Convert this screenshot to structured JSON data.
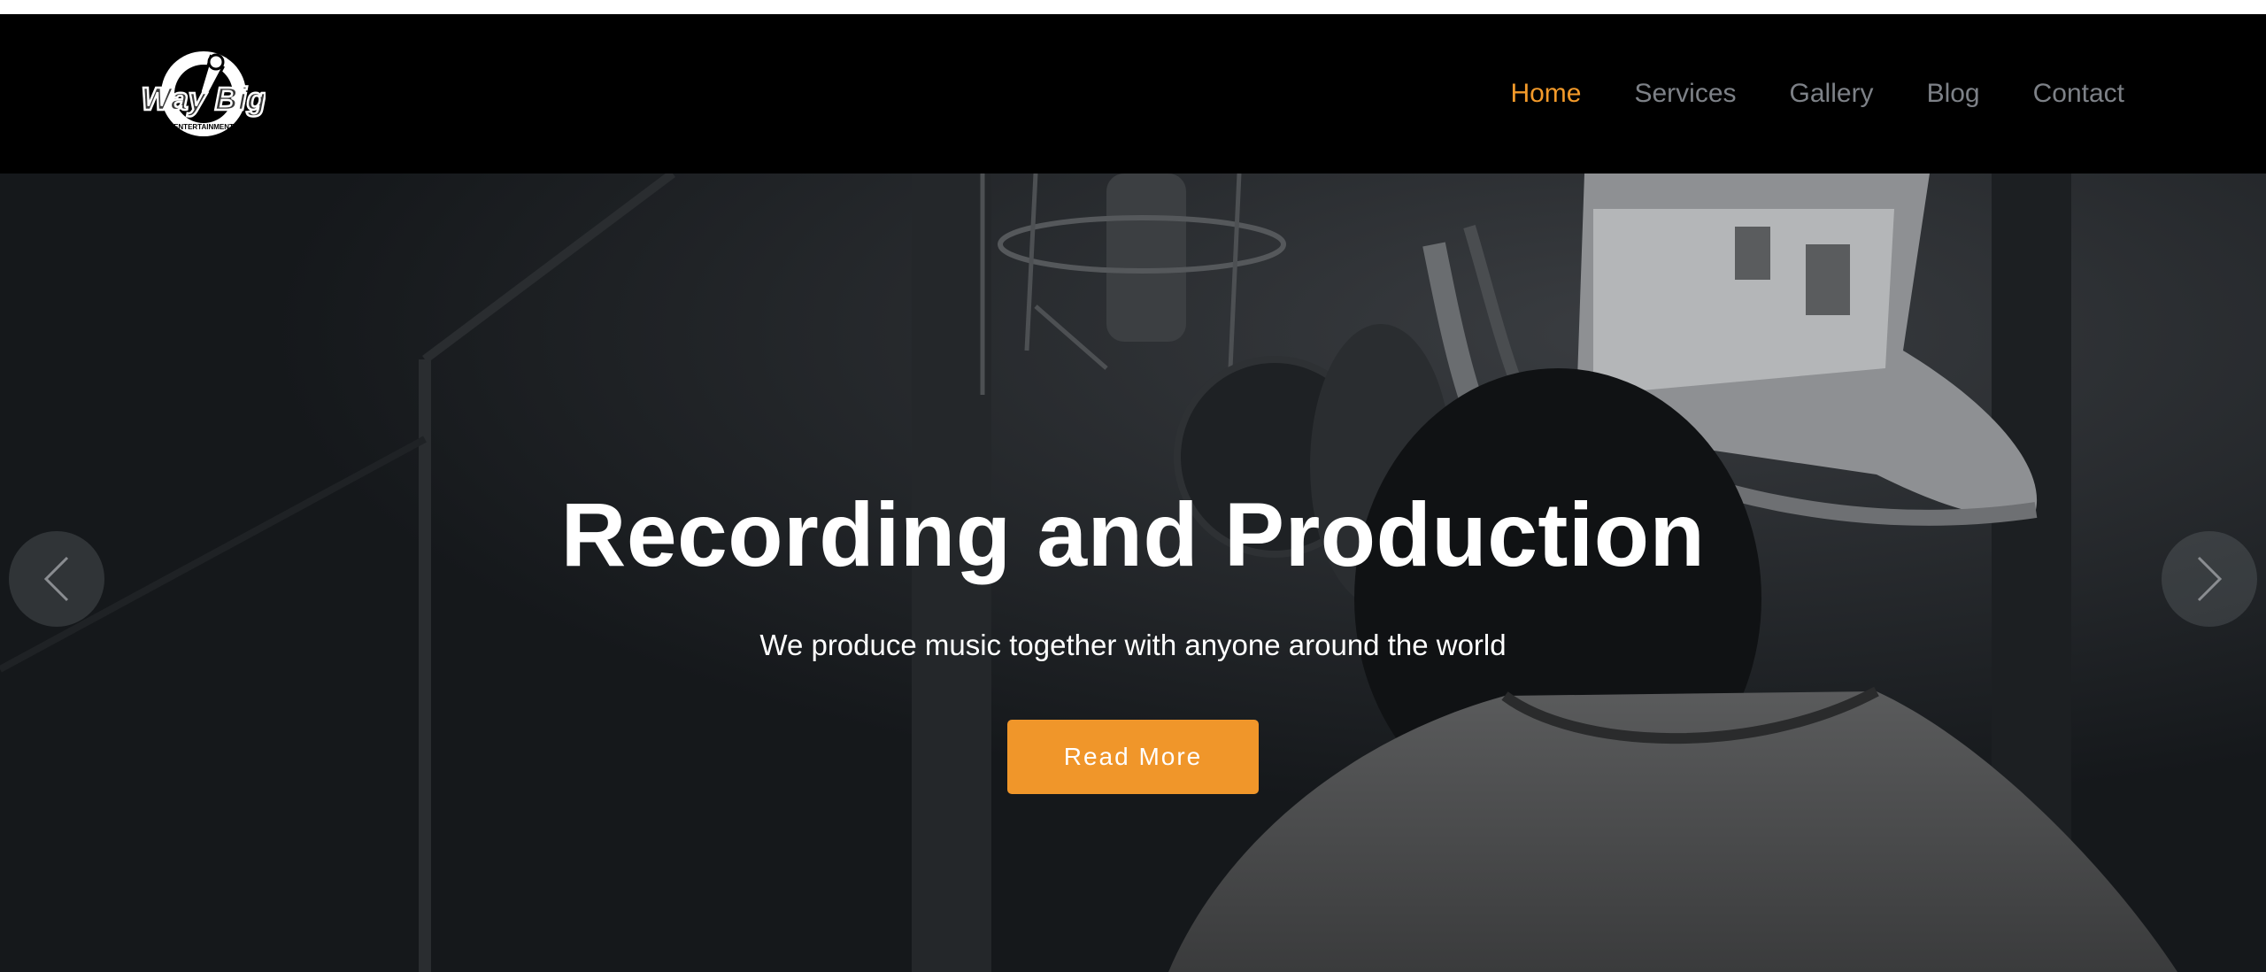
{
  "brand": {
    "logo_alt": "Way Big Entertainment"
  },
  "nav": {
    "items": [
      {
        "label": "Home",
        "active": true
      },
      {
        "label": "Services",
        "active": false
      },
      {
        "label": "Gallery",
        "active": false
      },
      {
        "label": "Blog",
        "active": false
      },
      {
        "label": "Contact",
        "active": false
      }
    ]
  },
  "hero": {
    "title": "Recording and Production",
    "subtitle": "We produce music together with anyone around the world",
    "button_label": "Read More",
    "prev_icon": "chevron-left-icon",
    "next_icon": "chevron-right-icon"
  },
  "colors": {
    "accent": "#f39a2a",
    "button": "#f0962a",
    "header_bg": "#000000",
    "hero_bg": "#15181b",
    "nav_text": "#7d8187"
  }
}
